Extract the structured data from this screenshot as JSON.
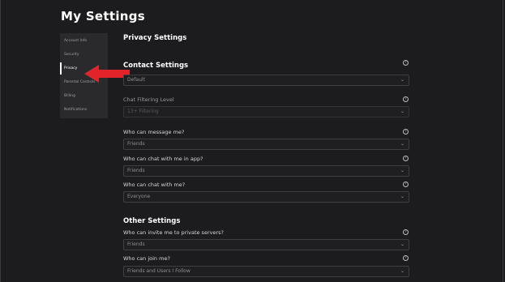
{
  "page": {
    "title": "My Settings"
  },
  "sidebar": {
    "items": [
      {
        "label": "Account Info",
        "active": false
      },
      {
        "label": "Security",
        "active": false
      },
      {
        "label": "Privacy",
        "active": true
      },
      {
        "label": "Parental Controls",
        "active": false
      },
      {
        "label": "Billing",
        "active": false
      },
      {
        "label": "Notifications",
        "active": false
      }
    ]
  },
  "annotation": {
    "arrow_color": "#e0242a"
  },
  "privacy": {
    "heading": "Privacy Settings",
    "contact": {
      "heading": "Contact Settings",
      "value": "Default"
    },
    "chat_filtering": {
      "label": "Chat Filtering Level",
      "value": "13+ Filtering"
    },
    "message": {
      "label": "Who can message me?",
      "value": "Friends"
    },
    "chat_in_app": {
      "label": "Who can chat with me in app?",
      "value": "Friends"
    },
    "chat": {
      "label": "Who can chat with me?",
      "value": "Everyone"
    },
    "other": {
      "heading": "Other Settings"
    },
    "private_servers": {
      "label": "Who can invite me to private servers?",
      "value": "Friends"
    },
    "join": {
      "label": "Who can join me?",
      "value": "Friends and Users I Follow"
    }
  },
  "icons": {
    "help": "?",
    "chevron": "⌄"
  }
}
